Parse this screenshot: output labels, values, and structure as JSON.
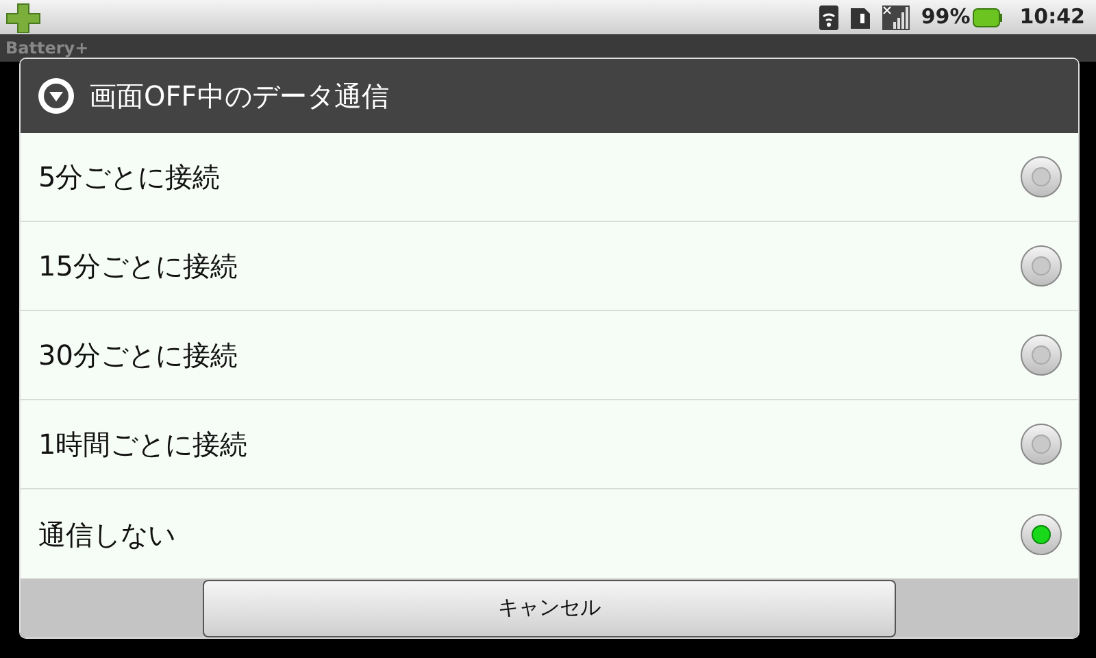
{
  "status_bar": {
    "battery_percent": "99%",
    "time": "10:42"
  },
  "app": {
    "title": "Battery+"
  },
  "dialog": {
    "title": "画面OFF中のデータ通信",
    "options": [
      {
        "label": "5分ごとに接続",
        "selected": false
      },
      {
        "label": "15分ごとに接続",
        "selected": false
      },
      {
        "label": "30分ごとに接続",
        "selected": false
      },
      {
        "label": "1時間ごとに接続",
        "selected": false
      },
      {
        "label": "通信しない",
        "selected": true
      }
    ],
    "cancel_button": "キャンセル"
  }
}
